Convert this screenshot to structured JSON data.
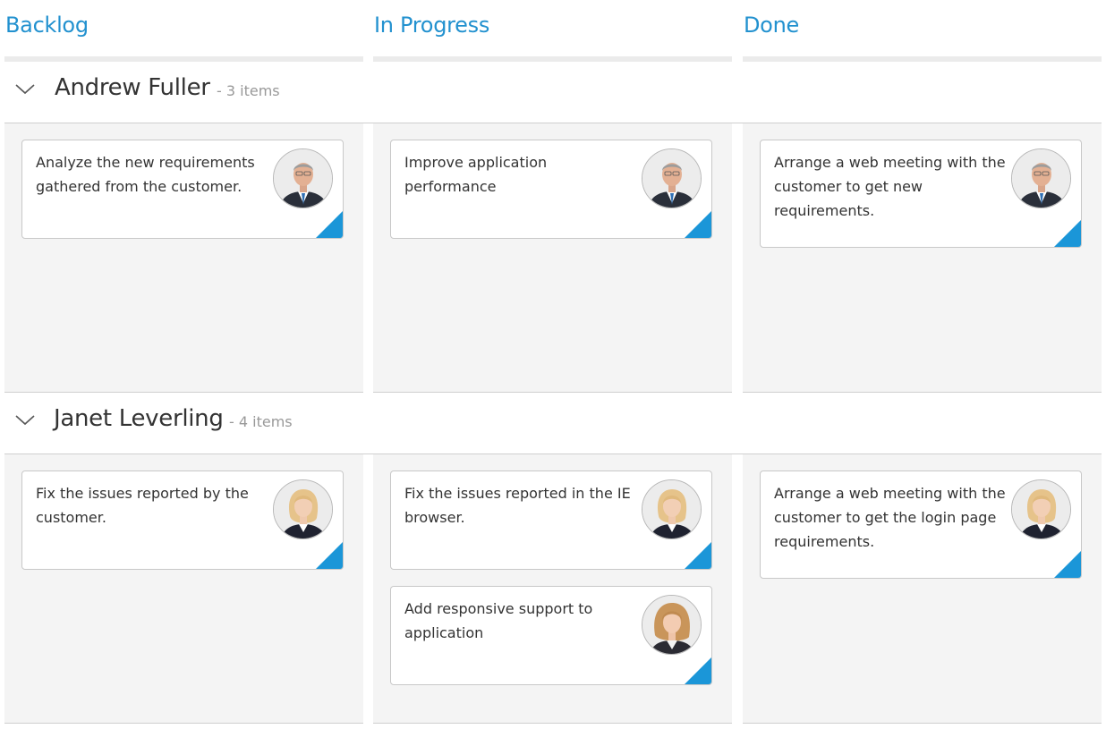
{
  "columns": [
    {
      "title": "Backlog"
    },
    {
      "title": "In Progress"
    },
    {
      "title": "Done"
    }
  ],
  "swimlanes": [
    {
      "name": "Andrew Fuller",
      "count": "- 3 items"
    },
    {
      "name": "Janet Leverling",
      "count": "- 4 items"
    }
  ],
  "cards": {
    "andrew_backlog": {
      "summary": "Analyze the new requirements gathered from the customer.",
      "assignee": "Andrew Fuller"
    },
    "andrew_progress": {
      "summary": "Improve application performance",
      "assignee": "Andrew Fuller"
    },
    "andrew_done": {
      "summary": "Arrange a web meeting with the customer to get new requirements.",
      "assignee": "Andrew Fuller"
    },
    "janet_backlog": {
      "summary": "Fix the issues reported by the customer.",
      "assignee": "Janet Leverling"
    },
    "janet_progress_1": {
      "summary": "Fix the issues reported in the IE browser.",
      "assignee": "Janet Leverling"
    },
    "janet_progress_2": {
      "summary": "Add responsive support to application",
      "assignee": "Janet Leverling"
    },
    "janet_done": {
      "summary": "Arrange a web meeting with the customer to get the login page requirements.",
      "assignee": "Janet Leverling"
    }
  },
  "icons": {
    "collapse": "chevron-down-icon",
    "card_corner": "card-status-indicator"
  },
  "colors": {
    "accent": "#2291cf",
    "card_corner": "#1b96d8",
    "lane_background": "#f4f4f4",
    "header_bar": "#ebebeb",
    "count_text": "#999999"
  }
}
